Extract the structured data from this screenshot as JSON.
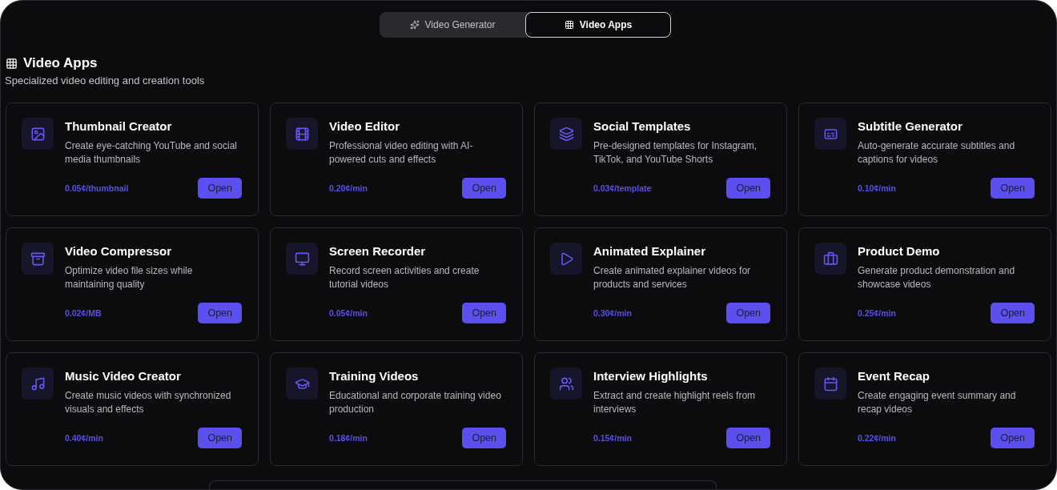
{
  "tabs": [
    {
      "label": "Video Generator",
      "selected": false
    },
    {
      "label": "Video Apps",
      "selected": true
    }
  ],
  "section": {
    "title": "Video Apps",
    "subtitle": "Specialized video editing and creation tools"
  },
  "apps": [
    {
      "name": "Thumbnail Creator",
      "description": "Create eye-catching YouTube and social media thumbnails",
      "price": "0.05¢/thumbnail",
      "button": "Open"
    },
    {
      "name": "Video Editor",
      "description": "Professional video editing with AI-powered cuts and effects",
      "price": "0.20¢/min",
      "button": "Open"
    },
    {
      "name": "Social Templates",
      "description": "Pre-designed templates for Instagram, TikTok, and YouTube Shorts",
      "price": "0.03¢/template",
      "button": "Open"
    },
    {
      "name": "Subtitle Generator",
      "description": "Auto-generate accurate subtitles and captions for videos",
      "price": "0.10¢/min",
      "button": "Open"
    },
    {
      "name": "Video Compressor",
      "description": "Optimize video file sizes while maintaining quality",
      "price": "0.02¢/MB",
      "button": "Open"
    },
    {
      "name": "Screen Recorder",
      "description": "Record screen activities and create tutorial videos",
      "price": "0.05¢/min",
      "button": "Open"
    },
    {
      "name": "Animated Explainer",
      "description": "Create animated explainer videos for products and services",
      "price": "0.30¢/min",
      "button": "Open"
    },
    {
      "name": "Product Demo",
      "description": "Generate product demonstration and showcase videos",
      "price": "0.25¢/min",
      "button": "Open"
    },
    {
      "name": "Music Video Creator",
      "description": "Create music videos with synchronized visuals and effects",
      "price": "0.40¢/min",
      "button": "Open"
    },
    {
      "name": "Training Videos",
      "description": "Educational and corporate training video production",
      "price": "0.18¢/min",
      "button": "Open"
    },
    {
      "name": "Interview Highlights",
      "description": "Extract and create highlight reels from interviews",
      "price": "0.15¢/min",
      "button": "Open"
    },
    {
      "name": "Event Recap",
      "description": "Create engaging event summary and recap videos",
      "price": "0.22¢/min",
      "button": "Open"
    }
  ]
}
